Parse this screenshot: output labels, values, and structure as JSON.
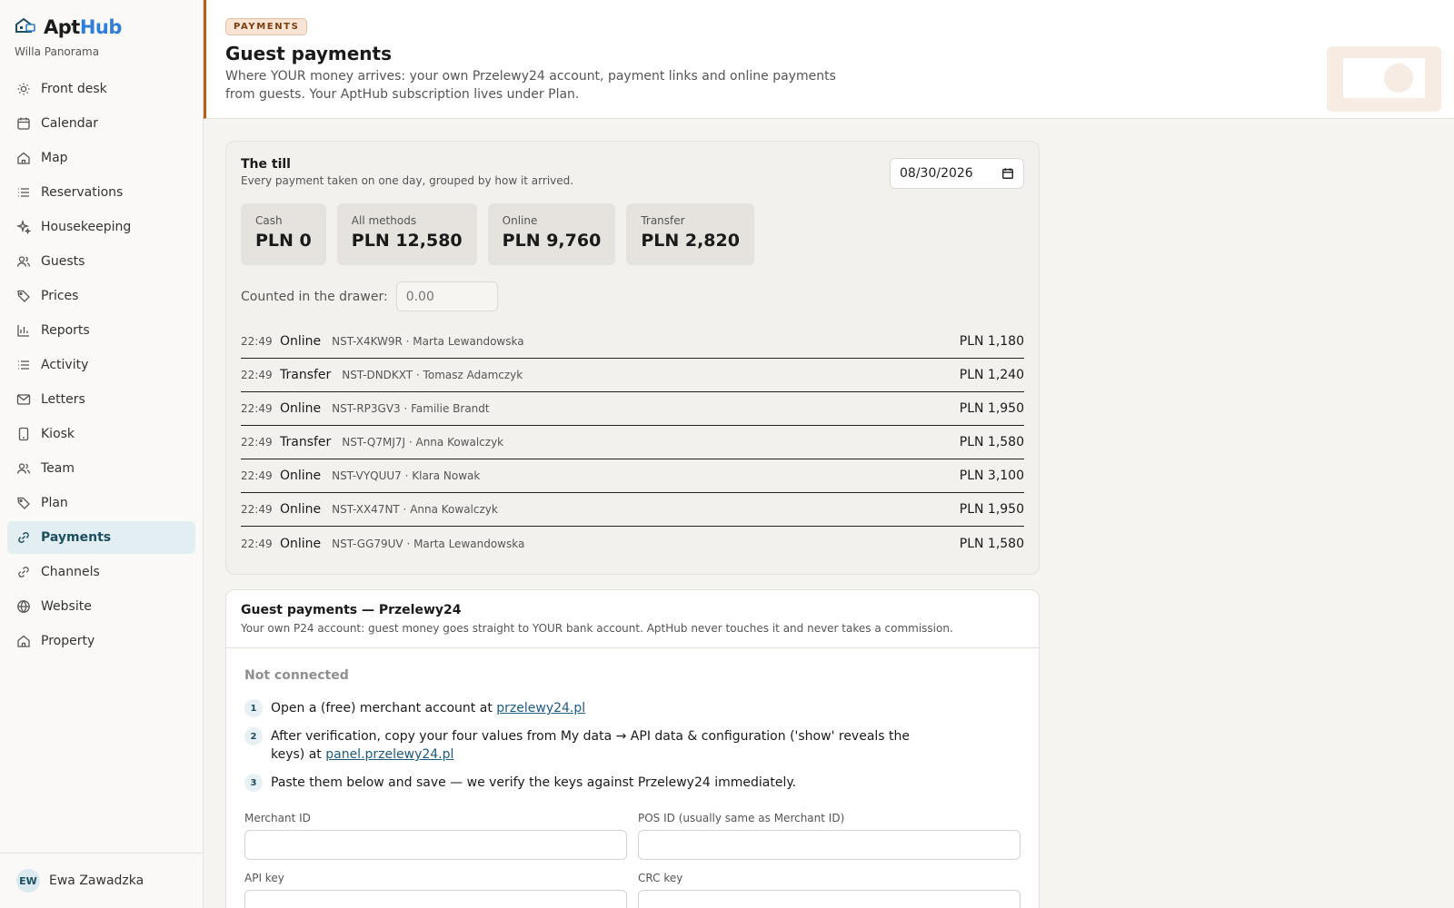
{
  "brand": {
    "name_part1": "Apt",
    "name_part2": "Hub",
    "property": "Willa Panorama"
  },
  "sidebar": {
    "items": [
      {
        "label": "Front desk",
        "icon": "sun-icon"
      },
      {
        "label": "Calendar",
        "icon": "calendar-icon"
      },
      {
        "label": "Map",
        "icon": "home-icon"
      },
      {
        "label": "Reservations",
        "icon": "list-icon"
      },
      {
        "label": "Housekeeping",
        "icon": "sparkle-icon"
      },
      {
        "label": "Guests",
        "icon": "users-icon"
      },
      {
        "label": "Prices",
        "icon": "tag-icon"
      },
      {
        "label": "Reports",
        "icon": "bar-chart-icon"
      },
      {
        "label": "Activity",
        "icon": "list-icon"
      },
      {
        "label": "Letters",
        "icon": "mail-icon"
      },
      {
        "label": "Kiosk",
        "icon": "tablet-icon"
      },
      {
        "label": "Team",
        "icon": "users-icon"
      },
      {
        "label": "Plan",
        "icon": "tag-icon"
      },
      {
        "label": "Payments",
        "icon": "link-icon",
        "active": true
      },
      {
        "label": "Channels",
        "icon": "link-icon"
      },
      {
        "label": "Website",
        "icon": "globe-icon"
      },
      {
        "label": "Property",
        "icon": "home-icon"
      }
    ],
    "user": {
      "initials": "EW",
      "name": "Ewa Zawadzka"
    }
  },
  "header": {
    "badge": "PAYMENTS",
    "title": "Guest payments",
    "description": "Where YOUR money arrives: your own Przelewy24 account, payment links and online payments from guests. Your AptHub subscription lives under Plan."
  },
  "till": {
    "title": "The till",
    "subtitle": "Every payment taken on one day, grouped by how it arrived.",
    "date": "08/30/2026",
    "stats": [
      {
        "label": "Cash",
        "value": "PLN 0"
      },
      {
        "label": "All methods",
        "value": "PLN 12,580"
      },
      {
        "label": "Online",
        "value": "PLN 9,760"
      },
      {
        "label": "Transfer",
        "value": "PLN 2,820"
      }
    ],
    "drawer_label": "Counted in the drawer:",
    "drawer_placeholder": "0.00",
    "transactions": [
      {
        "time": "22:49",
        "method": "Online",
        "ref": "NST-X4KW9R · Marta Lewandowska",
        "amount": "PLN 1,180"
      },
      {
        "time": "22:49",
        "method": "Transfer",
        "ref": "NST-DNDKXT · Tomasz Adamczyk",
        "amount": "PLN 1,240"
      },
      {
        "time": "22:49",
        "method": "Online",
        "ref": "NST-RP3GV3 · Familie Brandt",
        "amount": "PLN 1,950"
      },
      {
        "time": "22:49",
        "method": "Transfer",
        "ref": "NST-Q7MJ7J · Anna Kowalczyk",
        "amount": "PLN 1,580"
      },
      {
        "time": "22:49",
        "method": "Online",
        "ref": "NST-VYQUU7 · Klara Nowak",
        "amount": "PLN 3,100"
      },
      {
        "time": "22:49",
        "method": "Online",
        "ref": "NST-XX47NT · Anna Kowalczyk",
        "amount": "PLN 1,950"
      },
      {
        "time": "22:49",
        "method": "Online",
        "ref": "NST-GG79UV · Marta Lewandowska",
        "amount": "PLN 1,580"
      }
    ]
  },
  "p24": {
    "title": "Guest payments — Przelewy24",
    "subtitle": "Your own P24 account: guest money goes straight to YOUR bank account. AptHub never touches it and never takes a commission.",
    "status": "Not connected",
    "steps": [
      {
        "num": "1",
        "text": "Open a (free) merchant account at ",
        "link": "przelewy24.pl"
      },
      {
        "num": "2",
        "text": "After verification, copy your four values from My data → API data & configuration ('show' reveals the keys) at ",
        "link": "panel.przelewy24.pl"
      },
      {
        "num": "3",
        "text": "Paste them below and save — we verify the keys against Przelewy24 immediately.",
        "link": ""
      }
    ],
    "fields": {
      "merchant_id": "Merchant ID",
      "pos_id": "POS ID (usually same as Merchant ID)",
      "api_key": "API key",
      "crc_key": "CRC key"
    }
  }
}
